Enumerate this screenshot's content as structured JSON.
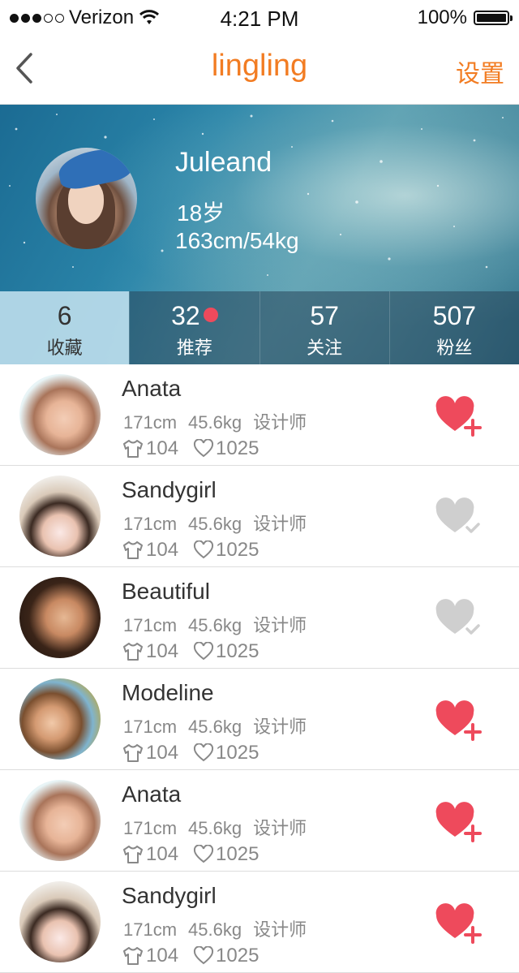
{
  "status_bar": {
    "carrier": "Verizon",
    "time": "4:21 PM",
    "battery": "100%"
  },
  "nav": {
    "title": "lingling",
    "settings_label": "设置"
  },
  "profile": {
    "name": "Juleand",
    "age": "18岁",
    "body": "163cm/54kg"
  },
  "stats": [
    {
      "num": "6",
      "label": "收藏",
      "active": true
    },
    {
      "num": "32",
      "label": "推荐",
      "dot": true
    },
    {
      "num": "57",
      "label": "关注"
    },
    {
      "num": "507",
      "label": "粉丝"
    }
  ],
  "users": [
    {
      "name": "Anata",
      "height": "171cm",
      "weight": "45.6kg",
      "job": "设计师",
      "clothes": "104",
      "likes": "1025",
      "followed": false
    },
    {
      "name": "Sandygirl",
      "height": "171cm",
      "weight": "45.6kg",
      "job": "设计师",
      "clothes": "104",
      "likes": "1025",
      "followed": true
    },
    {
      "name": "Beautiful",
      "height": "171cm",
      "weight": "45.6kg",
      "job": "设计师",
      "clothes": "104",
      "likes": "1025",
      "followed": true
    },
    {
      "name": "Modeline",
      "height": "171cm",
      "weight": "45.6kg",
      "job": "设计师",
      "clothes": "104",
      "likes": "1025",
      "followed": false
    },
    {
      "name": "Anata",
      "height": "171cm",
      "weight": "45.6kg",
      "job": "设计师",
      "clothes": "104",
      "likes": "1025",
      "followed": false
    },
    {
      "name": "Sandygirl",
      "height": "171cm",
      "weight": "45.6kg",
      "job": "设计师",
      "clothes": "104",
      "likes": "1025",
      "followed": false
    }
  ],
  "colors": {
    "accent": "#f27c22",
    "heart_active": "#ee4a5c",
    "heart_inactive": "#cfcfcf"
  },
  "icons": {
    "back": "chevron-left-icon",
    "wifi": "wifi-icon",
    "battery": "battery-icon",
    "shirt": "shirt-icon",
    "heart": "heart-icon",
    "add": "plus-icon",
    "check": "check-icon"
  }
}
